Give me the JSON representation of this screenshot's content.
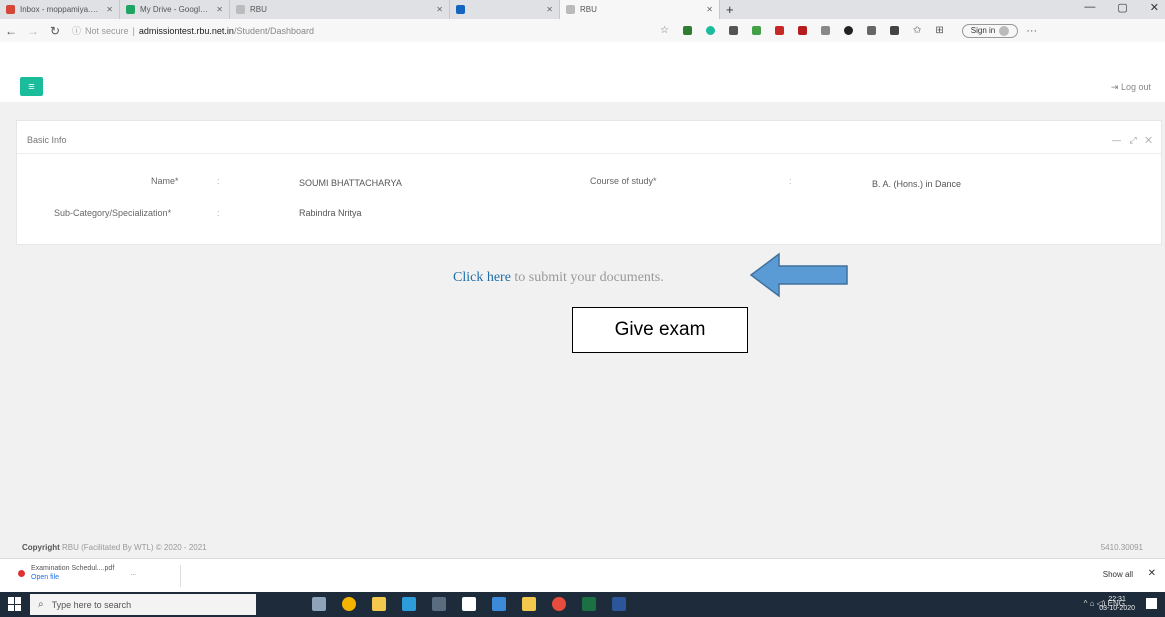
{
  "browser": {
    "tabs": [
      {
        "title": "Inbox - moppamiya.dasgupta@ ...",
        "color": "#d44638"
      },
      {
        "title": "My Drive - Google Drive",
        "color": "#1fa463"
      },
      {
        "title": "RBU",
        "color": "#999999"
      },
      {
        "title": "",
        "color": "#1565c0"
      },
      {
        "title": "RBU",
        "color": "#999999"
      }
    ],
    "new_tab": "+",
    "address": {
      "security": "Not secure",
      "host": "admissiontest.rbu.net.in",
      "path": "/Student/Dashboard"
    },
    "sign_in": "Sign in"
  },
  "page": {
    "logout": "Log out",
    "panel": {
      "title": "Basic Info",
      "tools": "— ⤢ ✕",
      "fields": {
        "name_label": "Name*",
        "name_value": "SOUMI BHATTACHARYA",
        "course_label": "Course of study*",
        "course_value": "B. A. (Hons.) in Dance",
        "subcat_label": "Sub-Category/Specialization*",
        "subcat_value": "Rabindra Nritya",
        "colon": ":"
      }
    },
    "submit": {
      "link": "Click here",
      "rest": " to submit your documents."
    },
    "annotation": "Give exam",
    "footer": {
      "copyright_bold": "Copyright",
      "copyright_rest": " RBU (Facilitated By WTL) © 2020 - 2021",
      "right": "5410.30091"
    }
  },
  "downloads": {
    "file": "Examination Schedul....pdf",
    "open": "Open file",
    "more": "...",
    "show_all": "Show all",
    "close": "✕"
  },
  "taskbar": {
    "search_placeholder": "Type here to search",
    "tray": "^ ⌂ ◁) ENG",
    "time": "22:31",
    "date": "03-10-2020"
  },
  "colors": {
    "accent": "#1abc9c",
    "link": "#1e6da8",
    "arrow": "#5b9bd5"
  }
}
